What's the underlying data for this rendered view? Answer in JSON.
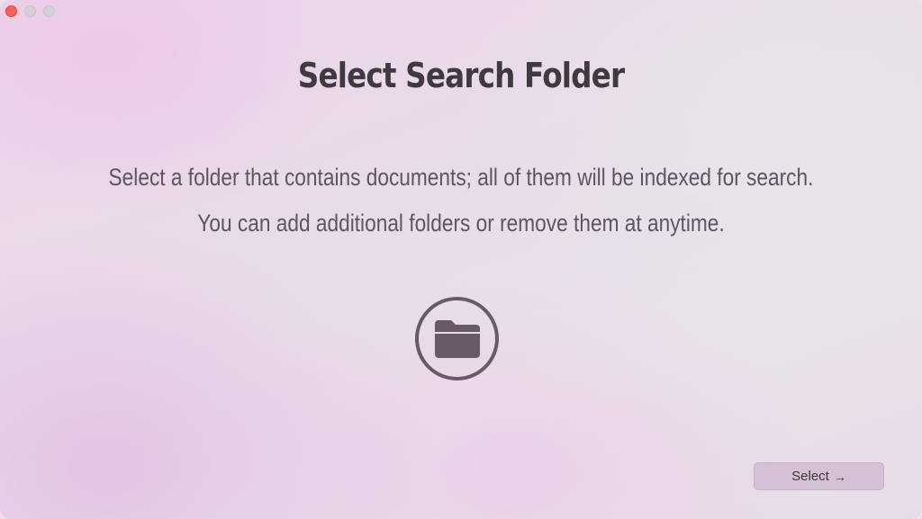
{
  "window": {
    "controls": [
      "close",
      "minimize",
      "zoom"
    ]
  },
  "main": {
    "title": "Select Search Folder",
    "description_line1": "Select a folder that contains documents; all of them will be indexed for search.",
    "description_line2": "You can add additional folders or remove them at anytime.",
    "folder_icon": "folder-icon"
  },
  "footer": {
    "select_label": "Select",
    "select_icon": "arrow-right-icon"
  },
  "colors": {
    "accent": "#6a5a68",
    "title": "#3f3a40",
    "close": "#fe5f57"
  }
}
